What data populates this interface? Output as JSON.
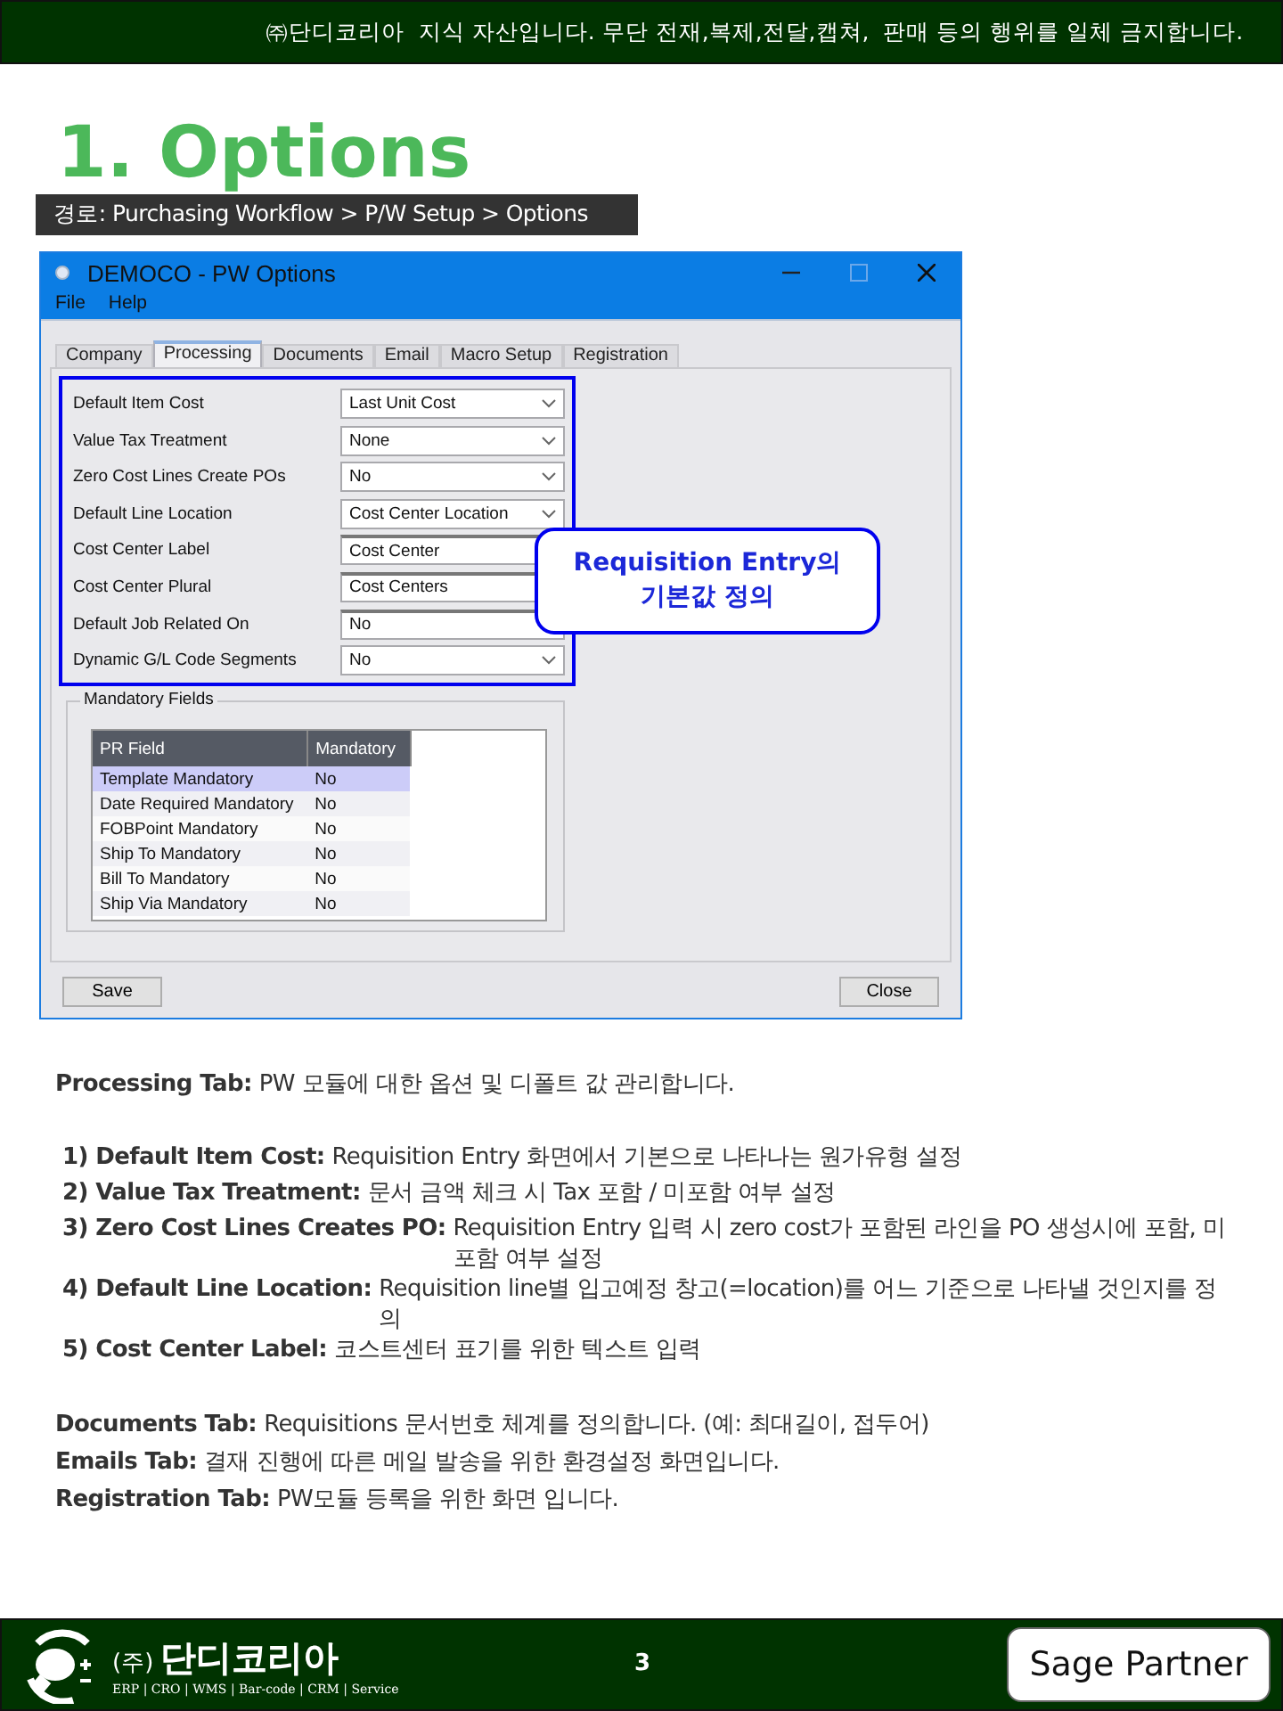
{
  "notice": "㈜단디코리아  지식 자산입니다. 무단 전재,복제,전달,캡쳐,  판매 등의 행위를 일체 금지합니다.",
  "title": "1. Options",
  "path": "경로: Purchasing Workflow > P/W Setup > Options",
  "window": {
    "title": "DEMOCO - PW Options",
    "menu": [
      "File",
      "Help"
    ],
    "tabs": [
      {
        "label": "Company",
        "selected": false
      },
      {
        "label": "Processing",
        "selected": true
      },
      {
        "label": "Documents",
        "selected": false
      },
      {
        "label": "Email",
        "selected": false
      },
      {
        "label": "Macro Setup",
        "selected": false
      },
      {
        "label": "Registration",
        "selected": false
      }
    ],
    "fields": [
      {
        "label": "Default Item Cost",
        "value": "Last Unit Cost",
        "kind": "dropdown"
      },
      {
        "label": "Value Tax Treatment",
        "value": "None",
        "kind": "dropdown"
      },
      {
        "label": "Zero Cost Lines Create POs",
        "value": "No",
        "kind": "dropdown"
      },
      {
        "label": "Default Line Location",
        "value": "Cost Center Location",
        "kind": "dropdown"
      },
      {
        "label": "Cost Center Label",
        "value": "Cost Center",
        "kind": "text"
      },
      {
        "label": "Cost Center Plural",
        "value": "Cost Centers",
        "kind": "text"
      },
      {
        "label": "Default Job Related On",
        "value": "No",
        "kind": "text"
      },
      {
        "label": "Dynamic G/L Code Segments",
        "value": "No",
        "kind": "dropdown"
      }
    ],
    "callout": [
      "Requisition Entry의",
      "기본값 정의"
    ],
    "group": "Mandatory Fields",
    "table": {
      "columns": [
        "PR Field",
        "Mandatory"
      ],
      "rows": [
        {
          "cells": [
            "Template Mandatory",
            "No"
          ],
          "selected": true
        },
        {
          "cells": [
            "Date Required Mandatory",
            "No"
          ],
          "selected": false
        },
        {
          "cells": [
            "FOBPoint Mandatory",
            "No"
          ],
          "selected": false
        },
        {
          "cells": [
            "Ship To Mandatory",
            "No"
          ],
          "selected": false
        },
        {
          "cells": [
            "Bill To Mandatory",
            "No"
          ],
          "selected": false
        },
        {
          "cells": [
            "Ship Via Mandatory",
            "No"
          ],
          "selected": false
        }
      ]
    },
    "buttons": [
      "Save",
      "Close"
    ]
  },
  "notes": {
    "intro": {
      "label": "Processing Tab:",
      "text": "PW 모듈에 대한 옵션 및 디폴트 값 관리합니다."
    },
    "items": [
      {
        "label": "1) Default Item Cost:",
        "text": "Requisition Entry 화면에서 기본으로 나타나는 원가유형 설정"
      },
      {
        "label": "2) Value Tax Treatment:",
        "text": "문서 금액 체크 시 Tax 포함 / 미포함 여부 설정"
      },
      {
        "label": "3) Zero Cost Lines Creates PO:",
        "text": "Requisition Entry 입력 시 zero cost가 포함된 라인을 PO 생성시에 포함, 미포함 여부 설정"
      },
      {
        "label": "4) Default Line Location:",
        "text": "Requisition line별 입고예정 창고(=location)를 어느 기준으로 나타낼 것인지를 정의"
      },
      {
        "label": "5) Cost Center Label:",
        "text": "코스트센터 표기를 위한 텍스트 입력"
      }
    ],
    "tabs": [
      {
        "label": "Documents Tab:",
        "text": "Requisitions 문서번호 체계를 정의합니다. (예: 최대길이, 접두어)"
      },
      {
        "label": "Emails Tab:",
        "text": "결재 진행에 따른 메일 발송을 위한 환경설정 화면입니다."
      },
      {
        "label": "Registration Tab:",
        "text": "PW모듈 등록을 위한 화면 입니다."
      }
    ]
  },
  "footer": {
    "prefix": "(주)",
    "company": "단디코리아",
    "tagline": "ERP | CRO | WMS | Bar-code | CRM | Service",
    "page": "3",
    "partner": "Sage Partner"
  }
}
